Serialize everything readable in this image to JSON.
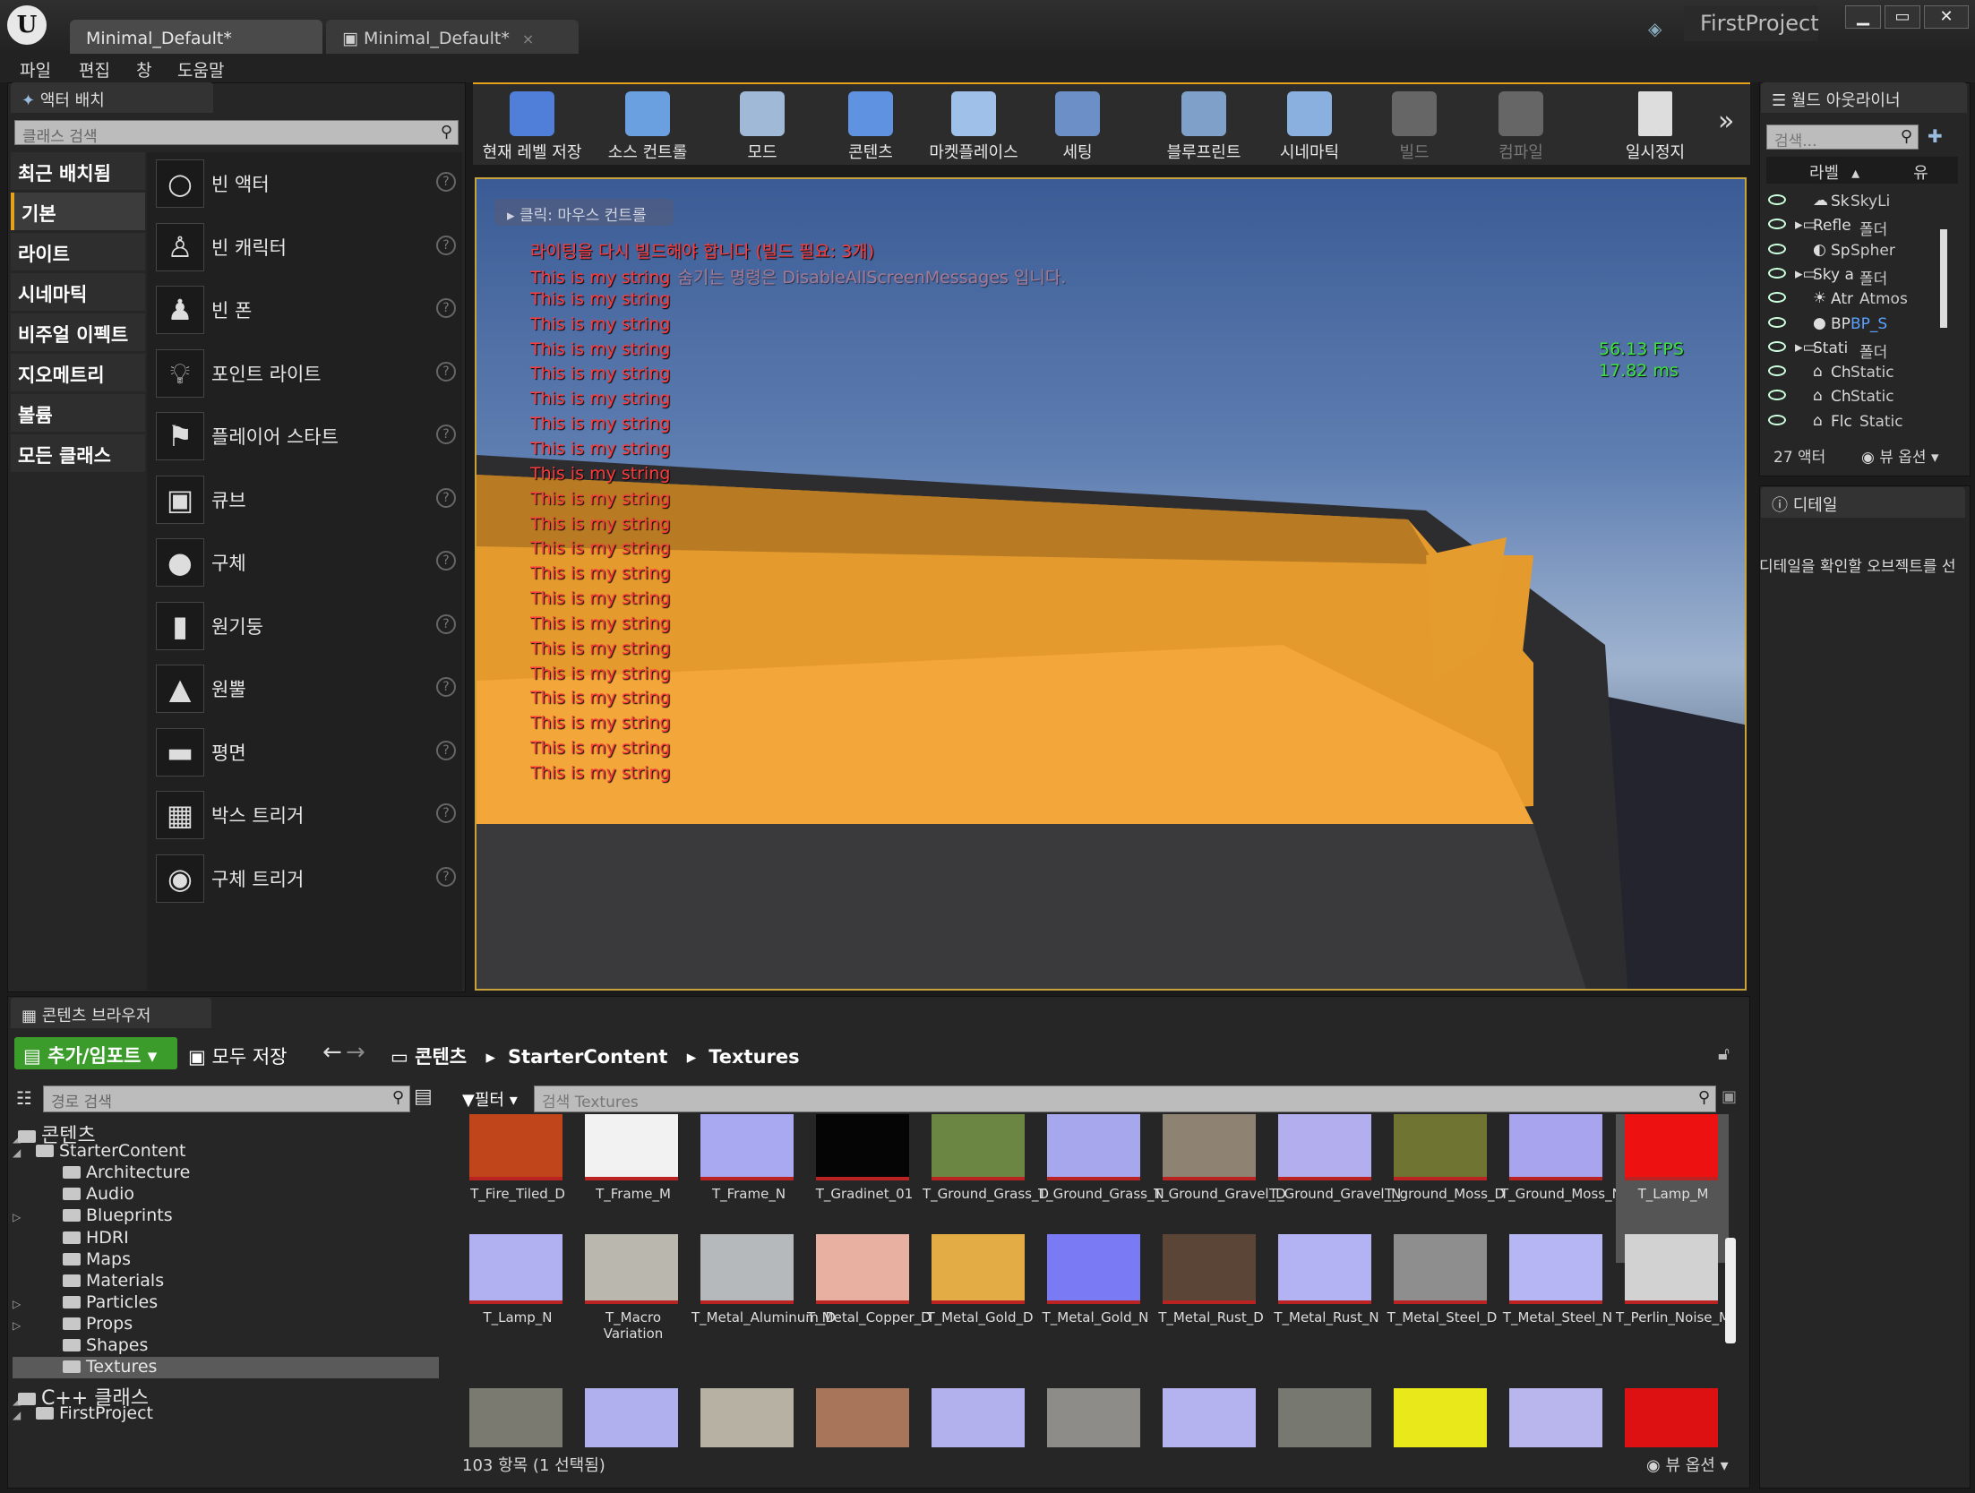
{
  "window": {
    "doc_tabs": [
      "Minimal_Default*",
      "Minimal_Default*"
    ],
    "project": "FirstProject",
    "controls": [
      "▁",
      "▭",
      "✕"
    ]
  },
  "menu": [
    "파일",
    "편집",
    "창",
    "도움말"
  ],
  "place_actors": {
    "tab": "액터 배치",
    "search_placeholder": "클래스 검색",
    "categories": [
      "최근 배치됨",
      "기본",
      "라이트",
      "시네마틱",
      "비주얼 이펙트",
      "지오메트리",
      "볼륨",
      "모든 클래스"
    ],
    "items": [
      "빈 액터",
      "빈 캐릭터",
      "빈 폰",
      "포인트 라이트",
      "플레이어 스타트",
      "큐브",
      "구체",
      "원기둥",
      "원뿔",
      "평면",
      "박스 트리거",
      "구체 트리거"
    ]
  },
  "toolbar": [
    {
      "label": "현재 레벨 저장",
      "icon": "save-icon"
    },
    {
      "label": "소스 컨트롤",
      "icon": "source-control-icon"
    },
    {
      "label": "모드",
      "icon": "modes-icon"
    },
    {
      "label": "콘텐츠",
      "icon": "content-icon"
    },
    {
      "label": "마켓플레이스",
      "icon": "marketplace-icon"
    },
    {
      "label": "세팅",
      "icon": "settings-icon"
    },
    {
      "label": "블루프린트",
      "icon": "blueprint-icon"
    },
    {
      "label": "시네마틱",
      "icon": "cinematics-icon"
    },
    {
      "label": "빌드",
      "icon": "build-icon"
    },
    {
      "label": "컴파일",
      "icon": "compile-icon"
    },
    {
      "label": "일시정지",
      "icon": "pause-icon"
    }
  ],
  "viewport": {
    "hint": "클릭: 마우스 컨트롤",
    "lighting_msg": "라이팅을 다시 빌드해야 합니다 (빌드 필요: 3개)",
    "debug_string": "This is my string",
    "hide_note": "숨기는 명령은 DisableAllScreenMessages 입니다.",
    "fps": "56.13 FPS",
    "ms": "17.82 ms"
  },
  "outliner": {
    "tab": "월드 아웃라이너",
    "search_placeholder": "검색...",
    "col_label": "라벨",
    "col_type": "유",
    "rows": [
      {
        "name": "Sk",
        "type": "SkyLi"
      },
      {
        "name": "Refle",
        "type": "폴더"
      },
      {
        "name": "Sp",
        "type": "Spher"
      },
      {
        "name": "Sky a",
        "type": "폴더"
      },
      {
        "name": "Atr",
        "type": "Atmos"
      },
      {
        "name": "BP",
        "type": "BP_S"
      },
      {
        "name": "Stati",
        "type": "폴더"
      },
      {
        "name": "Ch",
        "type": "Static"
      },
      {
        "name": "Ch",
        "type": "Static"
      },
      {
        "name": "Flc",
        "type": "Static"
      }
    ],
    "count": "27 액터",
    "view_options": "뷰 옵션"
  },
  "details": {
    "tab": "디테일",
    "hint": "디테일을 확인할 오브젝트를 선"
  },
  "content_browser": {
    "tab": "콘텐츠 브라우저",
    "add_import": "추가/임포트",
    "save_all": "모두 저장",
    "path": [
      "콘텐츠",
      "StarterContent",
      "Textures"
    ],
    "tree_search_placeholder": "경로 검색",
    "filter": "필터",
    "asset_search_placeholder": "검색 Textures",
    "tree": [
      {
        "label": "콘텐츠",
        "level": 0
      },
      {
        "label": "StarterContent",
        "level": 1
      },
      {
        "label": "Architecture",
        "level": 2
      },
      {
        "label": "Audio",
        "level": 2
      },
      {
        "label": "Blueprints",
        "level": 2
      },
      {
        "label": "HDRI",
        "level": 2
      },
      {
        "label": "Maps",
        "level": 2
      },
      {
        "label": "Materials",
        "level": 2
      },
      {
        "label": "Particles",
        "level": 2
      },
      {
        "label": "Props",
        "level": 2
      },
      {
        "label": "Shapes",
        "level": 2
      },
      {
        "label": "Textures",
        "level": 2
      },
      {
        "label": "C++ 클래스",
        "level": 0
      },
      {
        "label": "FirstProject",
        "level": 1
      }
    ],
    "assets_row1": [
      {
        "name": "T_Fire_Tiled_D",
        "color": "#c0451a"
      },
      {
        "name": "T_Frame_M",
        "color": "#f2f2f2"
      },
      {
        "name": "T_Frame_N",
        "color": "#a9a9f2"
      },
      {
        "name": "T_Gradinet_01",
        "color": "#050505"
      },
      {
        "name": "T_Ground_Grass_D",
        "color": "#6b8542"
      },
      {
        "name": "T_Ground_Grass_N",
        "color": "#a7a7ee"
      },
      {
        "name": "T_Ground_Gravel_D",
        "color": "#8e8272"
      },
      {
        "name": "T_Ground_Gravel_N",
        "color": "#b3aeee"
      },
      {
        "name": "T_ground_Moss_D",
        "color": "#6f7433"
      },
      {
        "name": "T_Ground_Moss_N",
        "color": "#a8a5ee"
      },
      {
        "name": "T_Lamp_M",
        "color": "#ee1111"
      }
    ],
    "assets_row2": [
      {
        "name": "T_Lamp_N",
        "color": "#b1b1f2"
      },
      {
        "name": "T_Macro Variation",
        "color": "#bab7ae"
      },
      {
        "name": "T_Metal_Aluminum_D",
        "color": "#b6b9bb"
      },
      {
        "name": "T_Metal_Copper_D",
        "color": "#e7b0a0"
      },
      {
        "name": "T_Metal_Gold_D",
        "color": "#e4ac44"
      },
      {
        "name": "T_Metal_Gold_N",
        "color": "#7a7af4"
      },
      {
        "name": "T_Metal_Rust_D",
        "color": "#5a4536"
      },
      {
        "name": "T_Metal_Rust_N",
        "color": "#b3b3f3"
      },
      {
        "name": "T_Metal_Steel_D",
        "color": "#8e8e8e"
      },
      {
        "name": "T_Metal_Steel_N",
        "color": "#b6b6f4"
      },
      {
        "name": "T_Perlin_Noise_M",
        "color": "#d2d2d2"
      }
    ],
    "assets_row3": [
      "#7a7a70",
      "#b0b0ee",
      "#b7b1a4",
      "#a8745a",
      "#b3b0ee",
      "#8e8c88",
      "#b5b2f0",
      "#777870",
      "#e8e81a",
      "#b9b6ee",
      "#dd1111"
    ],
    "status": "103 항목 (1 선택됨)",
    "view_options": "뷰 옵션"
  }
}
